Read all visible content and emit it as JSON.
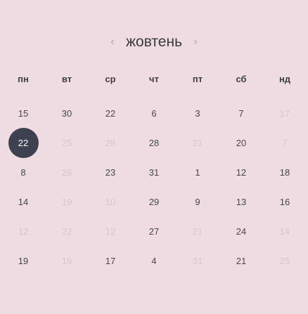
{
  "header": {
    "month": "жовтень",
    "prev_icon": "‹",
    "next_icon": "›"
  },
  "weekdays": [
    "пн",
    "вт",
    "ср",
    "чт",
    "пт",
    "сб",
    "нд"
  ],
  "weeks": [
    [
      {
        "d": "15",
        "o": false
      },
      {
        "d": "30",
        "o": false
      },
      {
        "d": "22",
        "o": false
      },
      {
        "d": "6",
        "o": false
      },
      {
        "d": "3",
        "o": false
      },
      {
        "d": "7",
        "o": false
      },
      {
        "d": "17",
        "o": true
      }
    ],
    [
      {
        "d": "22",
        "o": false,
        "sel": true
      },
      {
        "d": "25",
        "o": true
      },
      {
        "d": "28",
        "o": true
      },
      {
        "d": "28",
        "o": false
      },
      {
        "d": "21",
        "o": true
      },
      {
        "d": "20",
        "o": false
      },
      {
        "d": "7",
        "o": true
      }
    ],
    [
      {
        "d": "8",
        "o": false
      },
      {
        "d": "26",
        "o": true
      },
      {
        "d": "23",
        "o": false
      },
      {
        "d": "31",
        "o": false
      },
      {
        "d": "1",
        "o": false
      },
      {
        "d": "12",
        "o": false
      },
      {
        "d": "18",
        "o": false
      }
    ],
    [
      {
        "d": "14",
        "o": false
      },
      {
        "d": "19",
        "o": true
      },
      {
        "d": "10",
        "o": true
      },
      {
        "d": "29",
        "o": false
      },
      {
        "d": "9",
        "o": false
      },
      {
        "d": "13",
        "o": false
      },
      {
        "d": "16",
        "o": false
      }
    ],
    [
      {
        "d": "12",
        "o": true
      },
      {
        "d": "22",
        "o": true
      },
      {
        "d": "12",
        "o": true
      },
      {
        "d": "27",
        "o": false
      },
      {
        "d": "21",
        "o": true
      },
      {
        "d": "24",
        "o": false
      },
      {
        "d": "14",
        "o": true
      }
    ],
    [
      {
        "d": "19",
        "o": false
      },
      {
        "d": "19",
        "o": true
      },
      {
        "d": "17",
        "o": false
      },
      {
        "d": "4",
        "o": false
      },
      {
        "d": "31",
        "o": true
      },
      {
        "d": "21",
        "o": false
      },
      {
        "d": "25",
        "o": true
      }
    ]
  ],
  "colors": {
    "background": "#efdbe2",
    "selected": "#3e4250",
    "text": "#48474e",
    "muted": "#d3c8cf"
  }
}
